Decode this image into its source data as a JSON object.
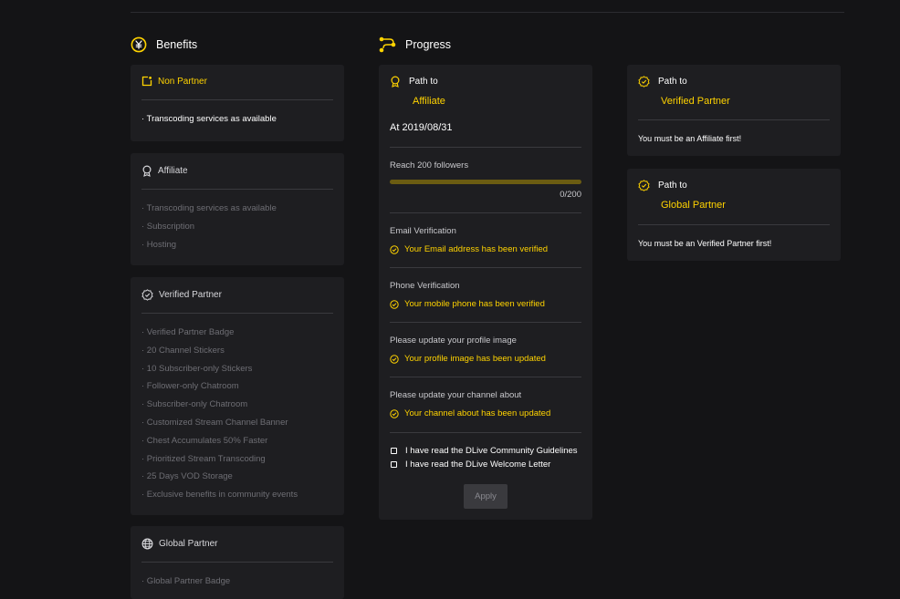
{
  "benefits": {
    "title": "Benefits",
    "non_partner": {
      "label": "Non Partner",
      "items": [
        "· Transcoding services as available"
      ]
    },
    "affiliate": {
      "label": "Affiliate",
      "items": [
        "· Transcoding services as available",
        "· Subscription",
        "· Hosting"
      ]
    },
    "verified_partner": {
      "label": "Verified Partner",
      "items": [
        "· Verified Partner Badge",
        "· 20 Channel Stickers",
        "· 10 Subscriber-only Stickers",
        "· Follower-only Chatroom",
        "· Subscriber-only Chatroom",
        "· Customized Stream Channel Banner",
        "· Chest Accumulates 50% Faster",
        "· Prioritized Stream Transcoding",
        "· 25 Days VOD Storage",
        "· Exclusive benefits in community events"
      ]
    },
    "global_partner": {
      "label": "Global Partner",
      "items": [
        "· Global Partner Badge"
      ]
    }
  },
  "progress": {
    "title": "Progress",
    "affiliate_path": {
      "path_label": "Path to",
      "target": "Affiliate",
      "date": "At 2019/08/31",
      "followers": {
        "label": "Reach 200 followers",
        "count": "0/200",
        "fraction": 0.0
      },
      "email": {
        "label": "Email Verification",
        "status": "Your Email address has been verified"
      },
      "phone": {
        "label": "Phone Verification",
        "status": "Your mobile phone has been verified"
      },
      "profile_image": {
        "label": "Please update your profile image",
        "status": "Your profile image has been updated"
      },
      "channel_about": {
        "label": "Please update your channel about",
        "status": "Your channel about has been updated"
      },
      "checkboxes": [
        "I have read the DLive Community Guidelines",
        "I have read the DLive Welcome Letter"
      ],
      "apply_label": "Apply"
    },
    "verified_path": {
      "path_label": "Path to",
      "target": "Verified Partner",
      "note": "You must be an Affiliate first!"
    },
    "global_path": {
      "path_label": "Path to",
      "target": "Global Partner",
      "note": "You must be an Verified Partner first!"
    }
  },
  "colors": {
    "background": "#141416",
    "card": "#1e1e21",
    "accent": "#ffd300",
    "progress_track": "#6b5c12"
  }
}
